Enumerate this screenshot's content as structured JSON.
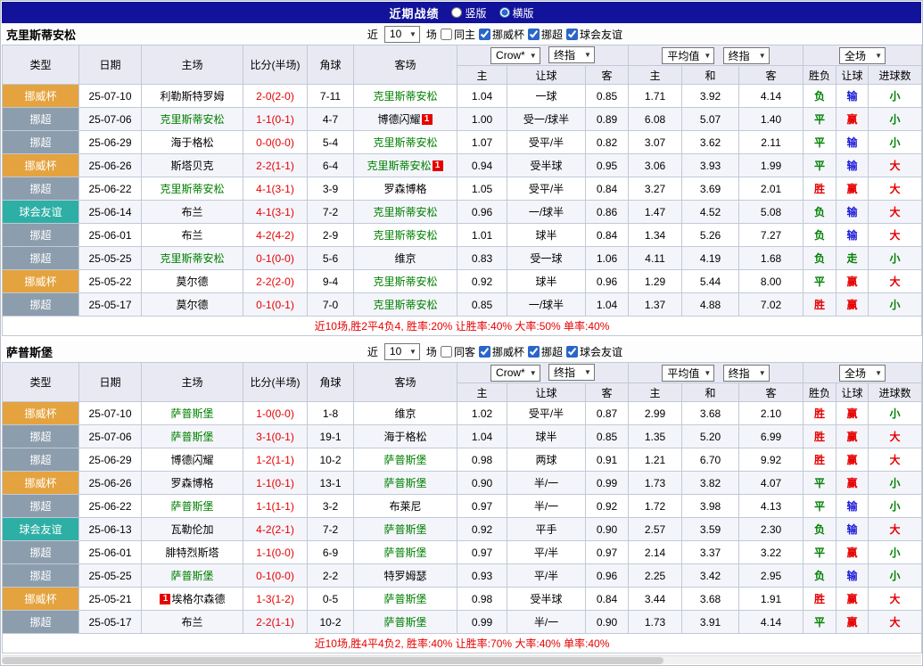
{
  "top_bar": {
    "title": "近期战绩",
    "layout_options": [
      {
        "label": "竖版",
        "selected": false
      },
      {
        "label": "横版",
        "selected": true
      }
    ]
  },
  "colors": {
    "top_bar_bg": "#12129B",
    "header_bg": "#E9E9F4",
    "row_alt_bg": "#F4F5FB",
    "border": "#C0CAD6",
    "team_highlight": "#008000",
    "score": "#E60000",
    "summary": "#E60000",
    "badge_bg": "#E60000",
    "type_bg": {
      "挪威杯": "#E4A33F",
      "挪超": "#8C9DAD",
      "球会友谊": "#2EAFA5"
    },
    "result_colors": {
      "胜": "#E60000",
      "平": "#008000",
      "负": "#008000",
      "赢": "#E60000",
      "输": "#1A1AD6",
      "走": "#008000",
      "大": "#E60000",
      "小": "#008000"
    }
  },
  "header_cols": {
    "type": "类型",
    "date": "日期",
    "home": "主场",
    "score": "比分(半场)",
    "corner": "角球",
    "away": "客场",
    "dd_group1": [
      "Crow*",
      "终指"
    ],
    "dd_group2": [
      "平均值",
      "终指"
    ],
    "dd_group3": "全场",
    "sub": [
      "主",
      "让球",
      "客",
      "主",
      "和",
      "客",
      "胜负",
      "让球",
      "进球数"
    ]
  },
  "sections": [
    {
      "team": "克里斯蒂安松",
      "filter": {
        "near": "近",
        "count": "10",
        "unit": "场",
        "same": {
          "label": "同主",
          "checked": false
        },
        "leagues": [
          {
            "label": "挪威杯",
            "checked": true
          },
          {
            "label": "挪超",
            "checked": true
          },
          {
            "label": "球会友谊",
            "checked": true
          }
        ]
      },
      "rows": [
        {
          "type": "挪威杯",
          "date": "25-07-10",
          "home": {
            "name": "利勒斯特罗姆"
          },
          "score": "2-0(2-0)",
          "corner": "7-11",
          "away": {
            "name": "克里斯蒂安松",
            "green": true
          },
          "odds": [
            "1.04",
            "一球",
            "0.85"
          ],
          "avg": [
            "1.71",
            "3.92",
            "4.14"
          ],
          "results": [
            "负",
            "输",
            "小"
          ]
        },
        {
          "type": "挪超",
          "date": "25-07-06",
          "home": {
            "name": "克里斯蒂安松",
            "green": true
          },
          "score": "1-1(0-1)",
          "corner": "4-7",
          "away": {
            "name": "博德闪耀",
            "badge": "1"
          },
          "odds": [
            "1.00",
            "受一/球半",
            "0.89"
          ],
          "avg": [
            "6.08",
            "5.07",
            "1.40"
          ],
          "results": [
            "平",
            "赢",
            "小"
          ]
        },
        {
          "type": "挪超",
          "date": "25-06-29",
          "home": {
            "name": "海于格松"
          },
          "score": "0-0(0-0)",
          "corner": "5-4",
          "away": {
            "name": "克里斯蒂安松",
            "green": true
          },
          "odds": [
            "1.07",
            "受平/半",
            "0.82"
          ],
          "avg": [
            "3.07",
            "3.62",
            "2.11"
          ],
          "results": [
            "平",
            "输",
            "小"
          ]
        },
        {
          "type": "挪威杯",
          "date": "25-06-26",
          "home": {
            "name": "斯塔贝克"
          },
          "score": "2-2(1-1)",
          "corner": "6-4",
          "away": {
            "name": "克里斯蒂安松",
            "green": true,
            "badge": "1"
          },
          "odds": [
            "0.94",
            "受半球",
            "0.95"
          ],
          "avg": [
            "3.06",
            "3.93",
            "1.99"
          ],
          "results": [
            "平",
            "输",
            "大"
          ]
        },
        {
          "type": "挪超",
          "date": "25-06-22",
          "home": {
            "name": "克里斯蒂安松",
            "green": true
          },
          "score": "4-1(3-1)",
          "corner": "3-9",
          "away": {
            "name": "罗森博格"
          },
          "odds": [
            "1.05",
            "受平/半",
            "0.84"
          ],
          "avg": [
            "3.27",
            "3.69",
            "2.01"
          ],
          "results": [
            "胜",
            "赢",
            "大"
          ]
        },
        {
          "type": "球会友谊",
          "date": "25-06-14",
          "home": {
            "name": "布兰"
          },
          "score": "4-1(3-1)",
          "corner": "7-2",
          "away": {
            "name": "克里斯蒂安松",
            "green": true
          },
          "odds": [
            "0.96",
            "一/球半",
            "0.86"
          ],
          "avg": [
            "1.47",
            "4.52",
            "5.08"
          ],
          "results": [
            "负",
            "输",
            "大"
          ]
        },
        {
          "type": "挪超",
          "date": "25-06-01",
          "home": {
            "name": "布兰"
          },
          "score": "4-2(4-2)",
          "corner": "2-9",
          "away": {
            "name": "克里斯蒂安松",
            "green": true
          },
          "odds": [
            "1.01",
            "球半",
            "0.84"
          ],
          "avg": [
            "1.34",
            "5.26",
            "7.27"
          ],
          "results": [
            "负",
            "输",
            "大"
          ]
        },
        {
          "type": "挪超",
          "date": "25-05-25",
          "home": {
            "name": "克里斯蒂安松",
            "green": true
          },
          "score": "0-1(0-0)",
          "corner": "5-6",
          "away": {
            "name": "维京"
          },
          "odds": [
            "0.83",
            "受一球",
            "1.06"
          ],
          "avg": [
            "4.11",
            "4.19",
            "1.68"
          ],
          "results": [
            "负",
            "走",
            "小"
          ]
        },
        {
          "type": "挪威杯",
          "date": "25-05-22",
          "home": {
            "name": "莫尔德"
          },
          "score": "2-2(2-0)",
          "corner": "9-4",
          "away": {
            "name": "克里斯蒂安松",
            "green": true
          },
          "odds": [
            "0.92",
            "球半",
            "0.96"
          ],
          "avg": [
            "1.29",
            "5.44",
            "8.00"
          ],
          "results": [
            "平",
            "赢",
            "大"
          ]
        },
        {
          "type": "挪超",
          "date": "25-05-17",
          "home": {
            "name": "莫尔德"
          },
          "score": "0-1(0-1)",
          "corner": "7-0",
          "away": {
            "name": "克里斯蒂安松",
            "green": true
          },
          "odds": [
            "0.85",
            "一/球半",
            "1.04"
          ],
          "avg": [
            "1.37",
            "4.88",
            "7.02"
          ],
          "results": [
            "胜",
            "赢",
            "小"
          ]
        }
      ],
      "summary": "近10场,胜2平4负4, 胜率:20% 让胜率:40% 大率:50% 单率:40%"
    },
    {
      "team": "萨普斯堡",
      "filter": {
        "near": "近",
        "count": "10",
        "unit": "场",
        "same": {
          "label": "同客",
          "checked": false
        },
        "leagues": [
          {
            "label": "挪威杯",
            "checked": true
          },
          {
            "label": "挪超",
            "checked": true
          },
          {
            "label": "球会友谊",
            "checked": true
          }
        ]
      },
      "rows": [
        {
          "type": "挪威杯",
          "date": "25-07-10",
          "home": {
            "name": "萨普斯堡",
            "green": true
          },
          "score": "1-0(0-0)",
          "corner": "1-8",
          "away": {
            "name": "维京"
          },
          "odds": [
            "1.02",
            "受平/半",
            "0.87"
          ],
          "avg": [
            "2.99",
            "3.68",
            "2.10"
          ],
          "results": [
            "胜",
            "赢",
            "小"
          ]
        },
        {
          "type": "挪超",
          "date": "25-07-06",
          "home": {
            "name": "萨普斯堡",
            "green": true
          },
          "score": "3-1(0-1)",
          "corner": "19-1",
          "away": {
            "name": "海于格松"
          },
          "odds": [
            "1.04",
            "球半",
            "0.85"
          ],
          "avg": [
            "1.35",
            "5.20",
            "6.99"
          ],
          "results": [
            "胜",
            "赢",
            "大"
          ]
        },
        {
          "type": "挪超",
          "date": "25-06-29",
          "home": {
            "name": "博德闪耀"
          },
          "score": "1-2(1-1)",
          "corner": "10-2",
          "away": {
            "name": "萨普斯堡",
            "green": true
          },
          "odds": [
            "0.98",
            "两球",
            "0.91"
          ],
          "avg": [
            "1.21",
            "6.70",
            "9.92"
          ],
          "results": [
            "胜",
            "赢",
            "大"
          ]
        },
        {
          "type": "挪威杯",
          "date": "25-06-26",
          "home": {
            "name": "罗森博格"
          },
          "score": "1-1(0-1)",
          "corner": "13-1",
          "away": {
            "name": "萨普斯堡",
            "green": true
          },
          "odds": [
            "0.90",
            "半/一",
            "0.99"
          ],
          "avg": [
            "1.73",
            "3.82",
            "4.07"
          ],
          "results": [
            "平",
            "赢",
            "小"
          ]
        },
        {
          "type": "挪超",
          "date": "25-06-22",
          "home": {
            "name": "萨普斯堡",
            "green": true
          },
          "score": "1-1(1-1)",
          "corner": "3-2",
          "away": {
            "name": "布莱尼"
          },
          "odds": [
            "0.97",
            "半/一",
            "0.92"
          ],
          "avg": [
            "1.72",
            "3.98",
            "4.13"
          ],
          "results": [
            "平",
            "输",
            "小"
          ]
        },
        {
          "type": "球会友谊",
          "date": "25-06-13",
          "home": {
            "name": "瓦勒伦加"
          },
          "score": "4-2(2-1)",
          "corner": "7-2",
          "away": {
            "name": "萨普斯堡",
            "green": true
          },
          "odds": [
            "0.92",
            "平手",
            "0.90"
          ],
          "avg": [
            "2.57",
            "3.59",
            "2.30"
          ],
          "results": [
            "负",
            "输",
            "大"
          ]
        },
        {
          "type": "挪超",
          "date": "25-06-01",
          "home": {
            "name": "腓特烈斯塔"
          },
          "score": "1-1(0-0)",
          "corner": "6-9",
          "away": {
            "name": "萨普斯堡",
            "green": true
          },
          "odds": [
            "0.97",
            "平/半",
            "0.97"
          ],
          "avg": [
            "2.14",
            "3.37",
            "3.22"
          ],
          "results": [
            "平",
            "赢",
            "小"
          ]
        },
        {
          "type": "挪超",
          "date": "25-05-25",
          "home": {
            "name": "萨普斯堡",
            "green": true
          },
          "score": "0-1(0-0)",
          "corner": "2-2",
          "away": {
            "name": "特罗姆瑟"
          },
          "odds": [
            "0.93",
            "平/半",
            "0.96"
          ],
          "avg": [
            "2.25",
            "3.42",
            "2.95"
          ],
          "results": [
            "负",
            "输",
            "小"
          ]
        },
        {
          "type": "挪威杯",
          "date": "25-05-21",
          "home": {
            "name": "埃格尔森德",
            "badge": "1",
            "badge_pos": "before"
          },
          "score": "1-3(1-2)",
          "corner": "0-5",
          "away": {
            "name": "萨普斯堡",
            "green": true
          },
          "odds": [
            "0.98",
            "受半球",
            "0.84"
          ],
          "avg": [
            "3.44",
            "3.68",
            "1.91"
          ],
          "results": [
            "胜",
            "赢",
            "大"
          ]
        },
        {
          "type": "挪超",
          "date": "25-05-17",
          "home": {
            "name": "布兰"
          },
          "score": "2-2(1-1)",
          "corner": "10-2",
          "away": {
            "name": "萨普斯堡",
            "green": true
          },
          "odds": [
            "0.99",
            "半/一",
            "0.90"
          ],
          "avg": [
            "1.73",
            "3.91",
            "4.14"
          ],
          "results": [
            "平",
            "赢",
            "大"
          ]
        }
      ],
      "summary": "近10场,胜4平4负2, 胜率:40% 让胜率:70% 大率:40% 单率:40%"
    }
  ]
}
